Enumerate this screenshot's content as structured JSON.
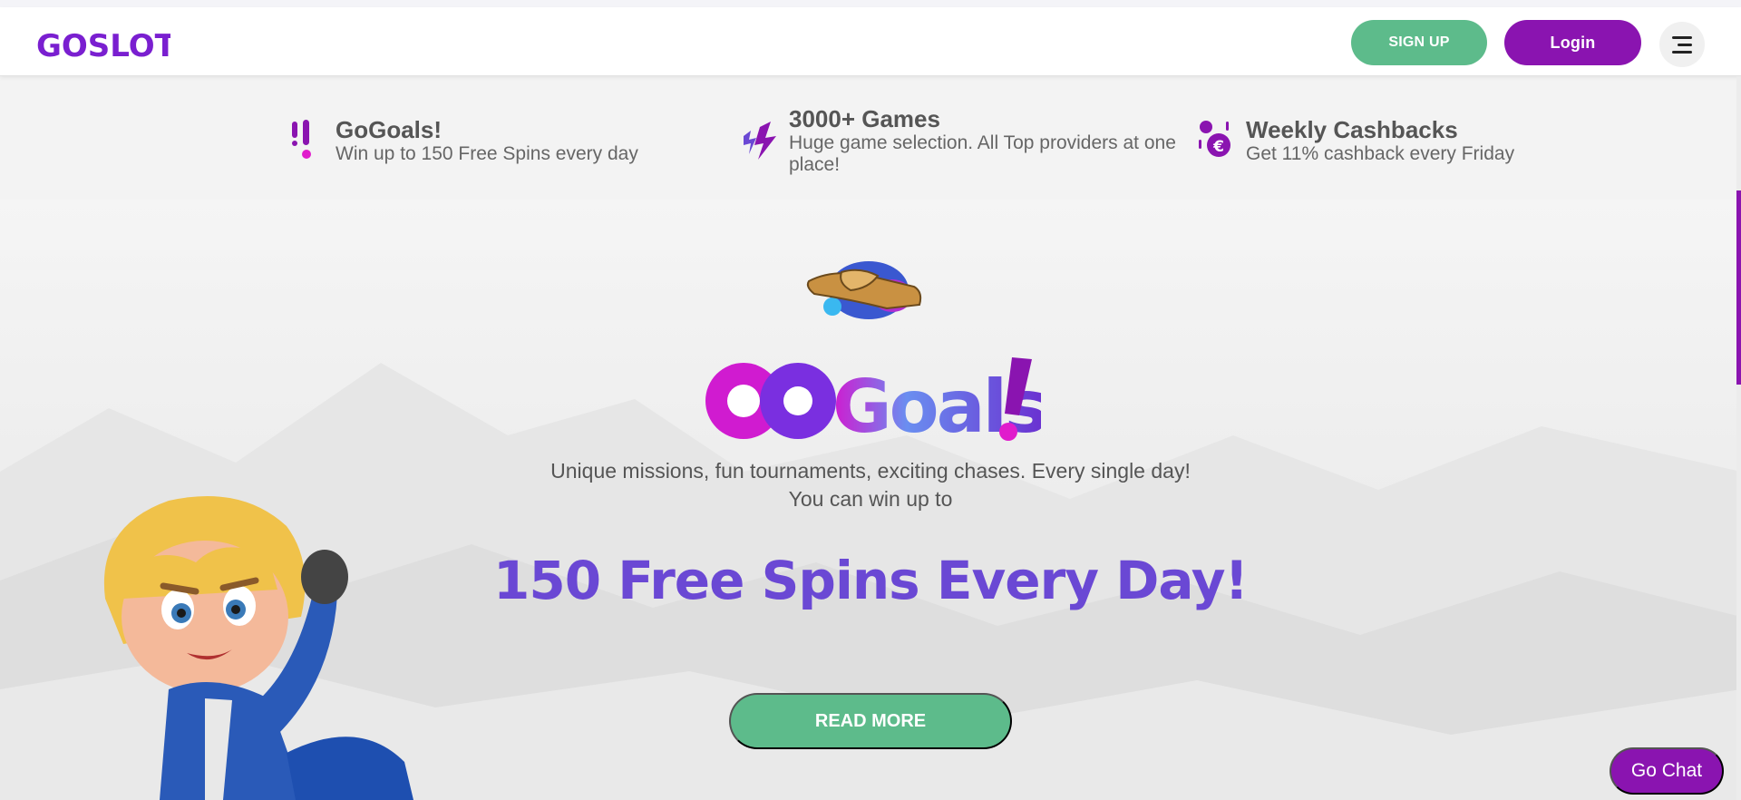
{
  "header": {
    "logo_text": "GOSLOT!",
    "signup_label": "SIGN UP",
    "login_label": "Login",
    "menu_icon": "hamburger-menu-icon"
  },
  "features": [
    {
      "icon": "exclamation-icon",
      "title": "GoGoals!",
      "description": "Win up to 150 Free Spins every day"
    },
    {
      "icon": "lightning-icon",
      "title": "3000+ Games",
      "description": "Huge game selection. All Top providers at one place!"
    },
    {
      "icon": "euro-cashback-icon",
      "title": "Weekly Cashbacks",
      "description": "Get 11% cashback every Friday"
    }
  ],
  "hero": {
    "logo_text": "GoGoals!",
    "description_line1": "Unique missions, fun tournaments, exciting chases. Every single day!",
    "description_line2": "You can win up to",
    "headline": "150 Free Spins Every Day!",
    "cta_label": "READ MORE"
  },
  "chat": {
    "label": "Go Chat"
  },
  "colors": {
    "brand_purple": "#8a14b0",
    "accent_green": "#5dbb8b",
    "headline_violet": "#6a48d4",
    "magenta": "#d01bd0"
  }
}
